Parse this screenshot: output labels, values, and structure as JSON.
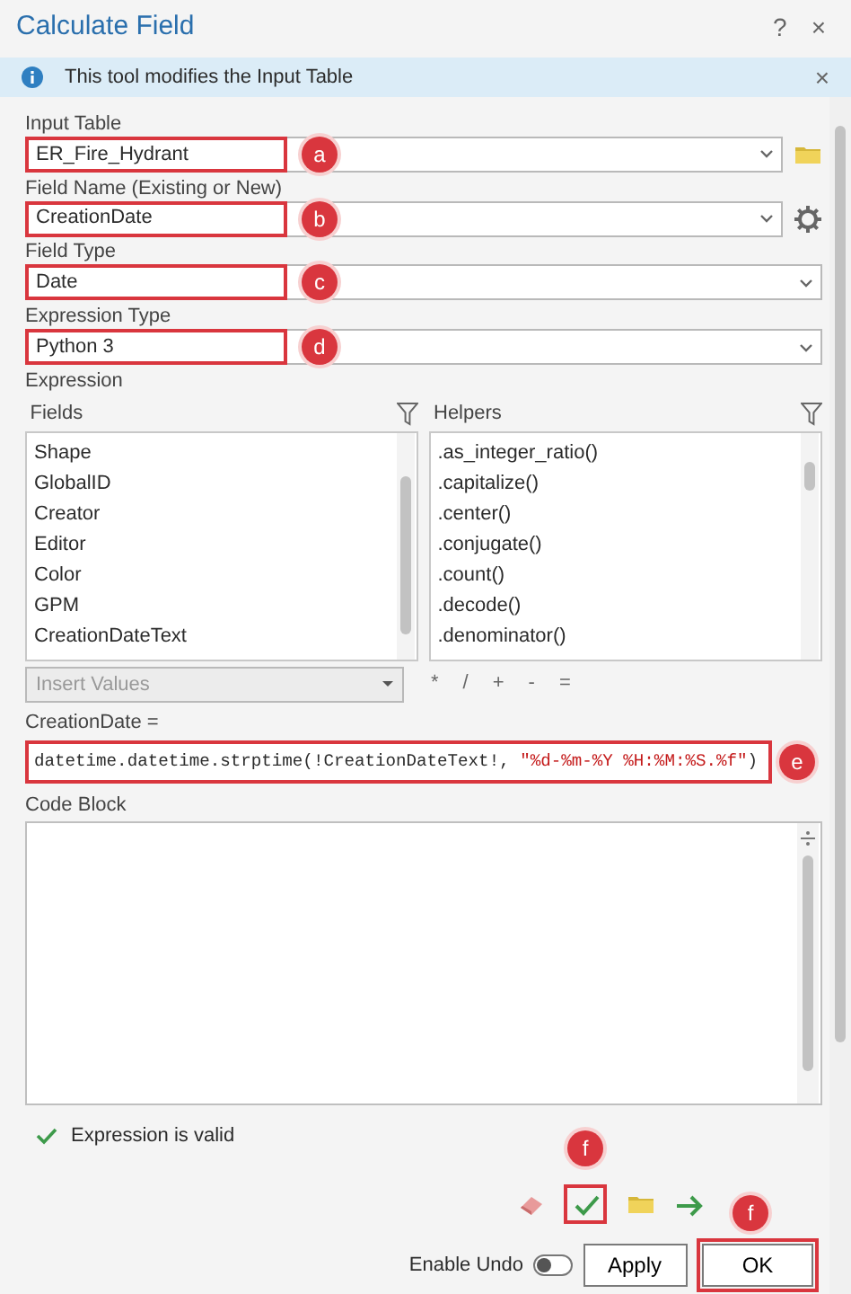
{
  "window": {
    "title": "Calculate Field",
    "help": "?",
    "close": "×"
  },
  "info_bar": {
    "message": "This tool modifies the Input Table",
    "close": "×"
  },
  "inputs": [
    {
      "label": "Input Table",
      "value": "ER_Fire_Hydrant",
      "callout": "a",
      "kind": "folder"
    },
    {
      "label": "Field Name (Existing or New)",
      "value": "CreationDate",
      "callout": "b",
      "kind": "gear"
    },
    {
      "label": "Field Type",
      "value": "Date",
      "callout": "c"
    },
    {
      "label": "Expression Type",
      "value": "Python 3",
      "callout": "d"
    }
  ],
  "expression_label": "Expression",
  "fields": {
    "title": "Fields",
    "items": [
      "Shape",
      "GlobalID",
      "Creator",
      "Editor",
      "Color",
      "GPM",
      "CreationDateText"
    ]
  },
  "helpers": {
    "title": "Helpers",
    "items": [
      ".as_integer_ratio()",
      ".capitalize()",
      ".center()",
      ".conjugate()",
      ".count()",
      ".decode()",
      ".denominator()"
    ]
  },
  "insert_values": {
    "placeholder": "Insert Values",
    "disabled": true
  },
  "operators": [
    "*",
    "/",
    "+",
    "-",
    "="
  ],
  "expression": {
    "label": "CreationDate =",
    "code": "datetime.datetime.strptime(!CreationDateText!, ",
    "string": "\"%d-%m-%Y %H:%M:%S.%f\"",
    "tail": ")",
    "callout": "e"
  },
  "code_block": {
    "label": "Code Block"
  },
  "validation": "Expression is valid",
  "tools": [
    {
      "kind": "eraser"
    },
    {
      "kind": "verify",
      "callout": "f"
    },
    {
      "kind": "folder"
    },
    {
      "kind": "arrow"
    }
  ],
  "footer": {
    "undo_label": "Enable Undo",
    "undo_on": false,
    "buttons": [
      {
        "label": "Apply"
      },
      {
        "label": "OK",
        "callout": "f"
      }
    ]
  }
}
